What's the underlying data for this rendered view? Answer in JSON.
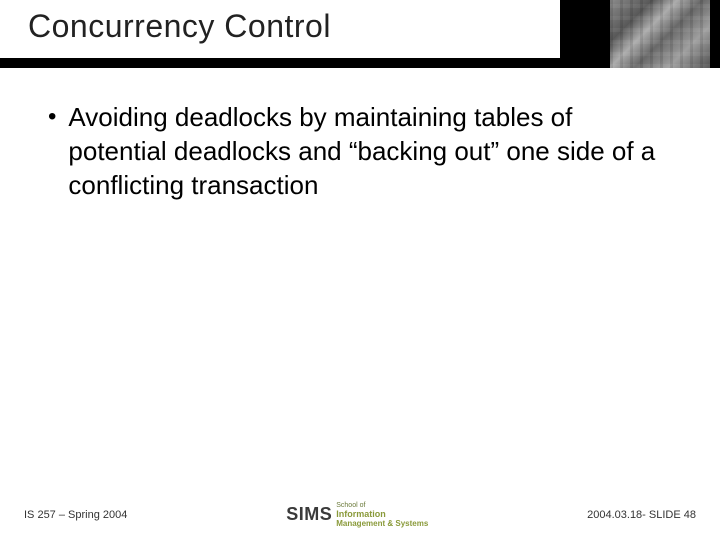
{
  "header": {
    "title": "Concurrency Control"
  },
  "body": {
    "bullet1": "Avoiding deadlocks by maintaining tables of potential deadlocks and “backing out” one side of a conflicting transaction"
  },
  "footer": {
    "left": "IS 257 – Spring 2004",
    "center_logo": "SIMS",
    "center_line1": "School of",
    "center_line2": "Information",
    "center_line3": "Management & Systems",
    "right": "2004.03.18- SLIDE 48"
  }
}
